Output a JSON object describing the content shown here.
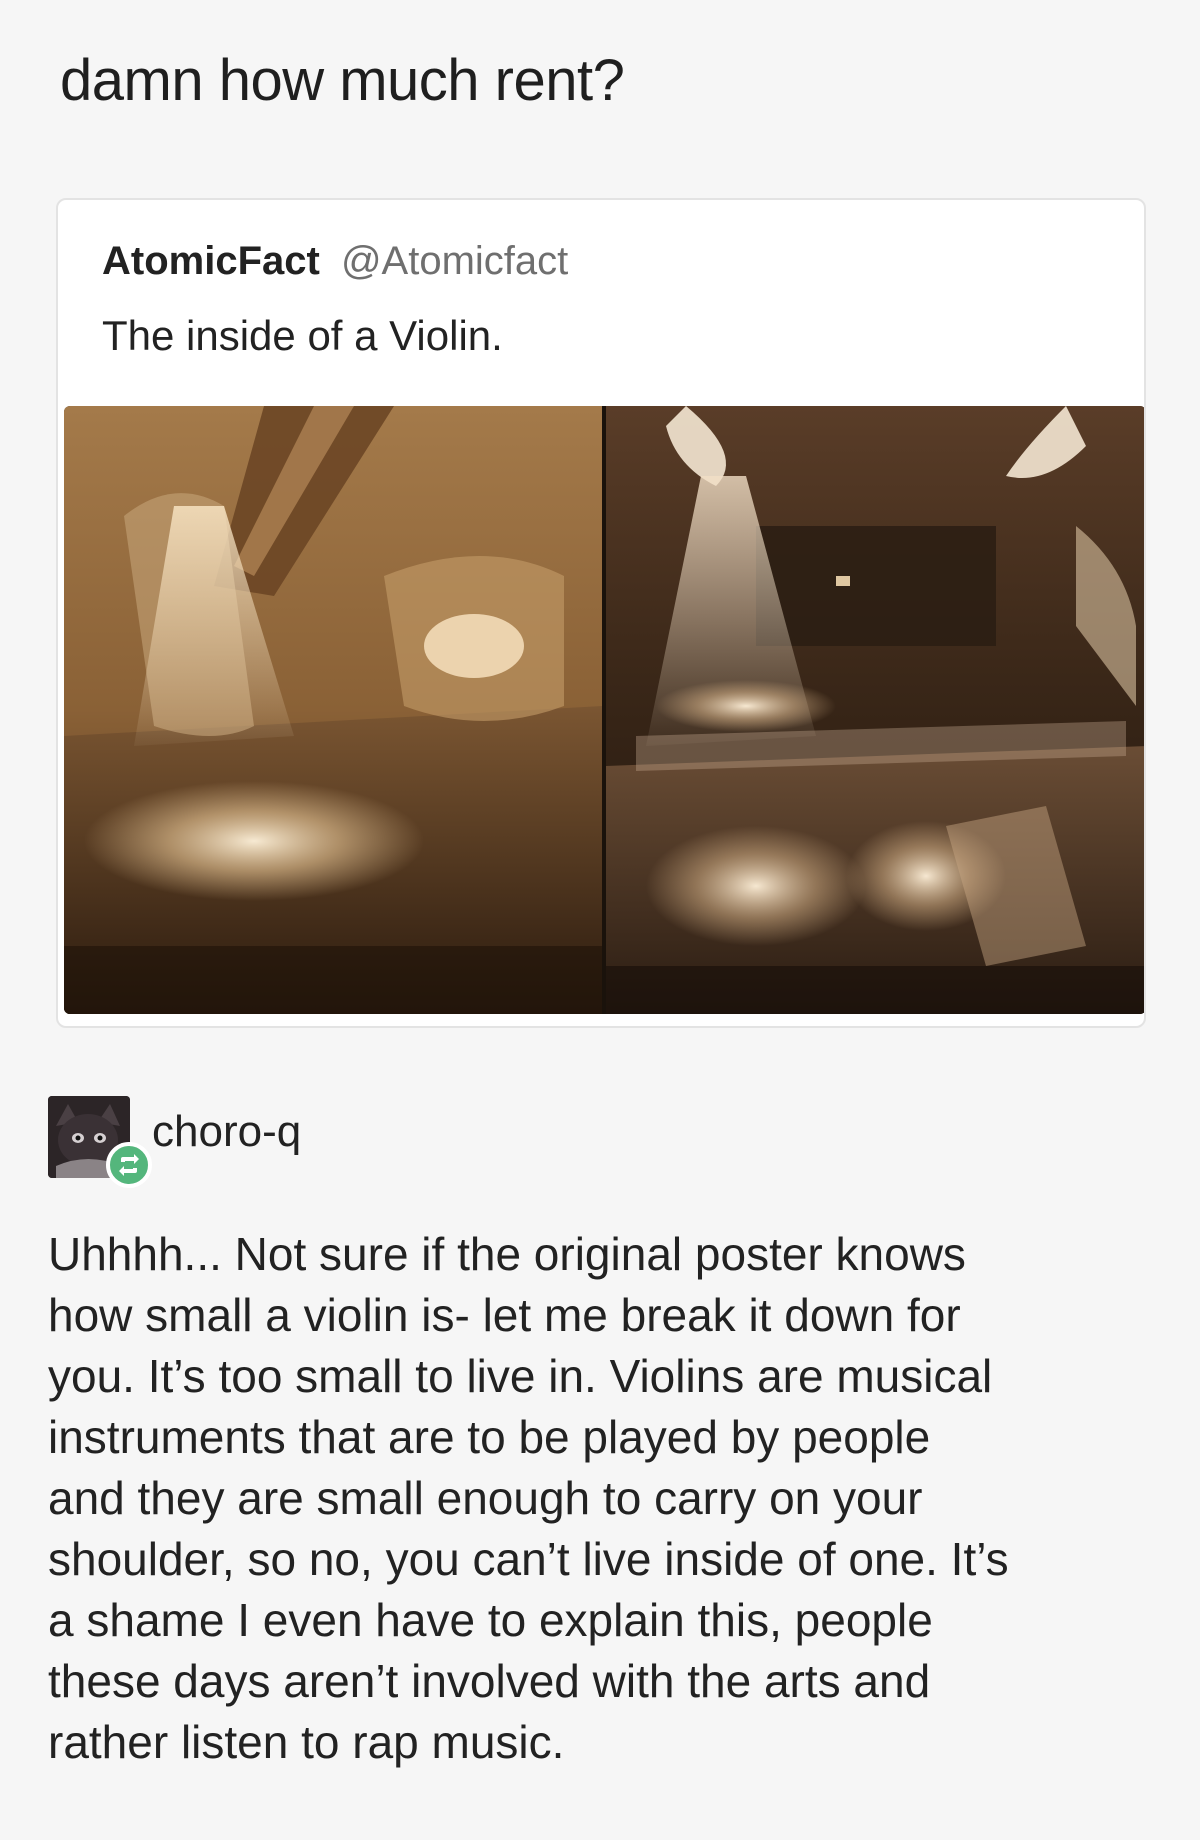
{
  "top_comment": {
    "text": "damn how much rent?"
  },
  "quoted_tweet": {
    "author_name": "AtomicFact",
    "author_handle": "@Atomicfact",
    "text": "The inside of a Violin.",
    "images": [
      {
        "icon": "violin-interior-photo-left"
      },
      {
        "icon": "violin-interior-photo-right"
      }
    ]
  },
  "reply": {
    "username": "choro-q",
    "avatar_icon": "cat-avatar",
    "badge_icon": "reblog-icon",
    "badge_color": "#54b67c",
    "body": "Uhhhh... Not sure if the original poster knows\nhow small a violin is- let me break it down for\nyou. It’s too small to live in. Violins are musical\ninstruments that are to be played by people\nand they are small enough to carry on your\nshoulder, so no, you can’t live inside of one. It’s\na shame I even have to explain this, people\nthese days aren’t involved with the arts and\nrather listen to rap music."
  }
}
